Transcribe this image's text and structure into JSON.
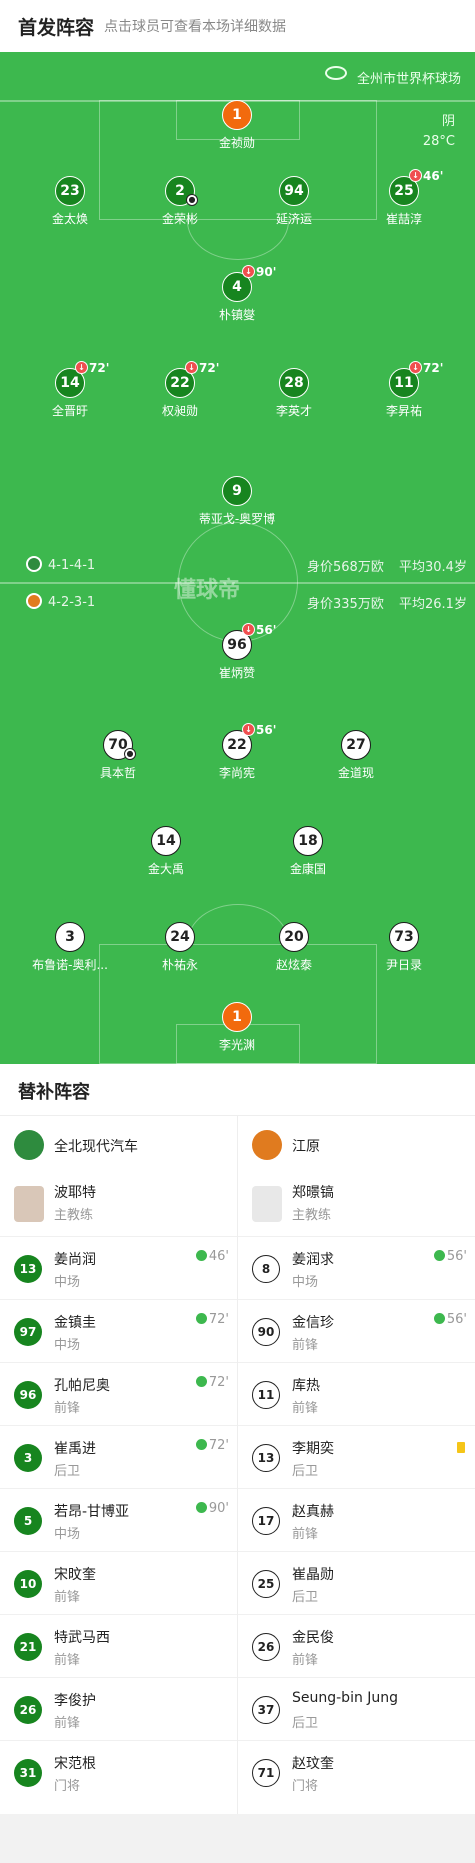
{
  "header": {
    "title": "首发阵容",
    "subtitle": "点击球员可查看本场详细数据"
  },
  "pitch": {
    "venue": "全州市世界杯球场",
    "weather": "阴",
    "temperature": "28°C",
    "logo": "懂球帝",
    "home_formation": "4-1-4-1",
    "home_value": "身价568万欧",
    "home_age": "平均30.4岁",
    "away_formation": "4-2-3-1",
    "away_value": "身价335万欧",
    "away_age": "平均26.1岁",
    "players": [
      {
        "num": "1",
        "name": "金祯勋",
        "kind": "g"
      },
      {
        "num": "23",
        "name": "金太焕",
        "kind": "h"
      },
      {
        "num": "2",
        "name": "金荣彬",
        "kind": "h"
      },
      {
        "num": "94",
        "name": "延济运",
        "kind": "h"
      },
      {
        "num": "25",
        "name": "崔喆淳",
        "kind": "h",
        "min": "46'"
      },
      {
        "num": "4",
        "name": "朴镇燮",
        "kind": "h",
        "min": "90'"
      },
      {
        "num": "14",
        "name": "全晋旴",
        "kind": "h",
        "min": "72'"
      },
      {
        "num": "22",
        "name": "权昶勋",
        "kind": "h",
        "min": "72'"
      },
      {
        "num": "28",
        "name": "李英才",
        "kind": "h"
      },
      {
        "num": "11",
        "name": "李昇祐",
        "kind": "h",
        "min": "72'"
      },
      {
        "num": "9",
        "name": "蒂亚戈-奥罗博",
        "kind": "h"
      },
      {
        "num": "96",
        "name": "崔炳赞",
        "kind": "a",
        "min": "56'"
      },
      {
        "num": "70",
        "name": "具本哲",
        "kind": "a"
      },
      {
        "num": "22",
        "name": "李尚宪",
        "kind": "a",
        "min": "56'"
      },
      {
        "num": "27",
        "name": "金道现",
        "kind": "a"
      },
      {
        "num": "14",
        "name": "金大禹",
        "kind": "a"
      },
      {
        "num": "18",
        "name": "金康国",
        "kind": "a"
      },
      {
        "num": "3",
        "name": "布鲁诺-奥利...",
        "kind": "a"
      },
      {
        "num": "24",
        "name": "朴祐永",
        "kind": "a"
      },
      {
        "num": "20",
        "name": "赵炫泰",
        "kind": "a"
      },
      {
        "num": "73",
        "name": "尹日录",
        "kind": "a"
      },
      {
        "num": "1",
        "name": "李光渊",
        "kind": "g"
      }
    ]
  },
  "subs": {
    "title": "替补阵容",
    "home": {
      "team": "全北现代汽车",
      "logo_color": "#2e8b3e",
      "coach": {
        "name": "波耶特",
        "role": "主教练"
      },
      "players": [
        {
          "num": "13",
          "name": "姜尚润",
          "pos": "中场",
          "min": "46'"
        },
        {
          "num": "97",
          "name": "金镇圭",
          "pos": "中场",
          "min": "72'"
        },
        {
          "num": "96",
          "name": "孔帕尼奥",
          "pos": "前锋",
          "min": "72'"
        },
        {
          "num": "3",
          "name": "崔禹进",
          "pos": "后卫",
          "min": "72'"
        },
        {
          "num": "5",
          "name": "若昂-甘博亚",
          "pos": "中场",
          "min": "90'"
        },
        {
          "num": "10",
          "name": "宋旼奎",
          "pos": "前锋"
        },
        {
          "num": "21",
          "name": "特武马西",
          "pos": "前锋"
        },
        {
          "num": "26",
          "name": "李俊护",
          "pos": "前锋"
        },
        {
          "num": "31",
          "name": "宋范根",
          "pos": "门将"
        }
      ]
    },
    "away": {
      "team": "江原",
      "logo_color": "#e07b1f",
      "coach": {
        "name": "郑暻镐",
        "role": "主教练"
      },
      "players": [
        {
          "num": "8",
          "name": "姜润求",
          "pos": "中场",
          "min": "56'"
        },
        {
          "num": "90",
          "name": "金信珍",
          "pos": "前锋",
          "min": "56'"
        },
        {
          "num": "11",
          "name": "库热",
          "pos": "前锋"
        },
        {
          "num": "13",
          "name": "李期奕",
          "pos": "后卫",
          "card": "yellow"
        },
        {
          "num": "17",
          "name": "赵真赫",
          "pos": "前锋"
        },
        {
          "num": "25",
          "name": "崔晶勋",
          "pos": "后卫"
        },
        {
          "num": "26",
          "name": "金民俊",
          "pos": "前锋"
        },
        {
          "num": "37",
          "name": "Seung-bin Jung",
          "pos": "后卫"
        },
        {
          "num": "71",
          "name": "赵玟奎",
          "pos": "门将"
        }
      ]
    }
  }
}
